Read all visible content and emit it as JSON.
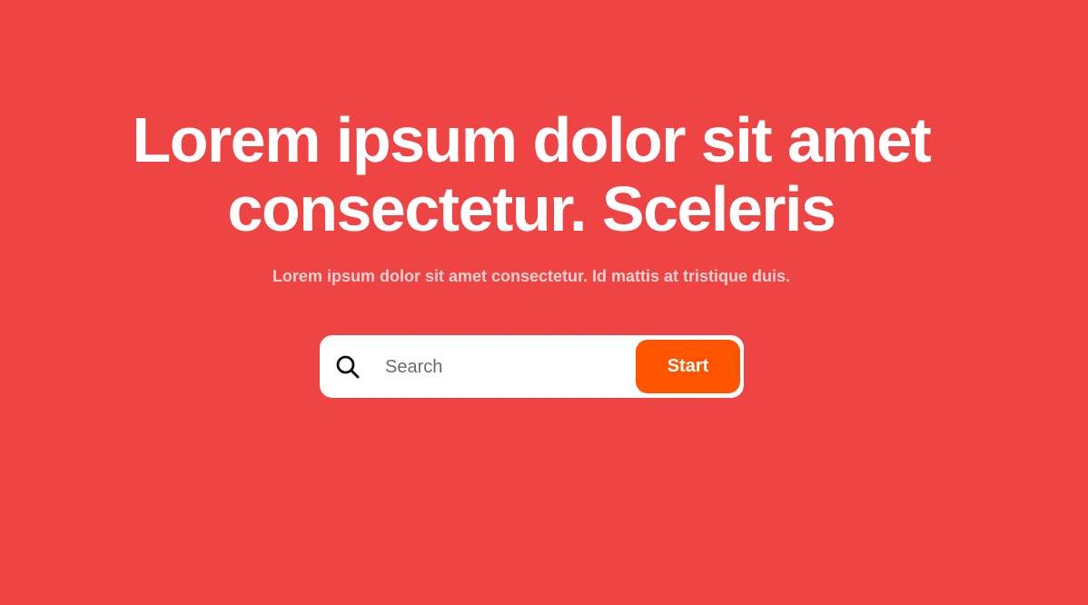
{
  "hero": {
    "headline_line1": "Lorem ipsum dolor sit amet",
    "headline_line2": "consectetur. Sceleris",
    "subtitle": "Lorem ipsum dolor sit amet consectetur. Id mattis at tristique duis."
  },
  "search": {
    "icon": "search-icon",
    "placeholder": "Search",
    "value": "",
    "button_label": "Start"
  },
  "colors": {
    "background": "#ef4444",
    "accent": "#ff5500",
    "text": "#ffffff"
  }
}
